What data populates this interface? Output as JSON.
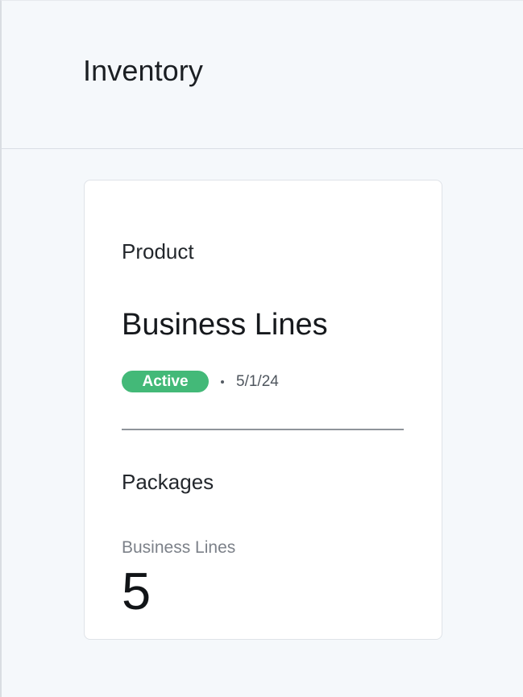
{
  "header": {
    "title": "Inventory"
  },
  "product_card": {
    "section_label": "Product",
    "product_name": "Business Lines",
    "status": {
      "label": "Active",
      "color": "#43b978"
    },
    "separator": "•",
    "date": "5/1/24",
    "packages_label": "Packages",
    "metric": {
      "label": "Business Lines",
      "value": "5"
    }
  }
}
